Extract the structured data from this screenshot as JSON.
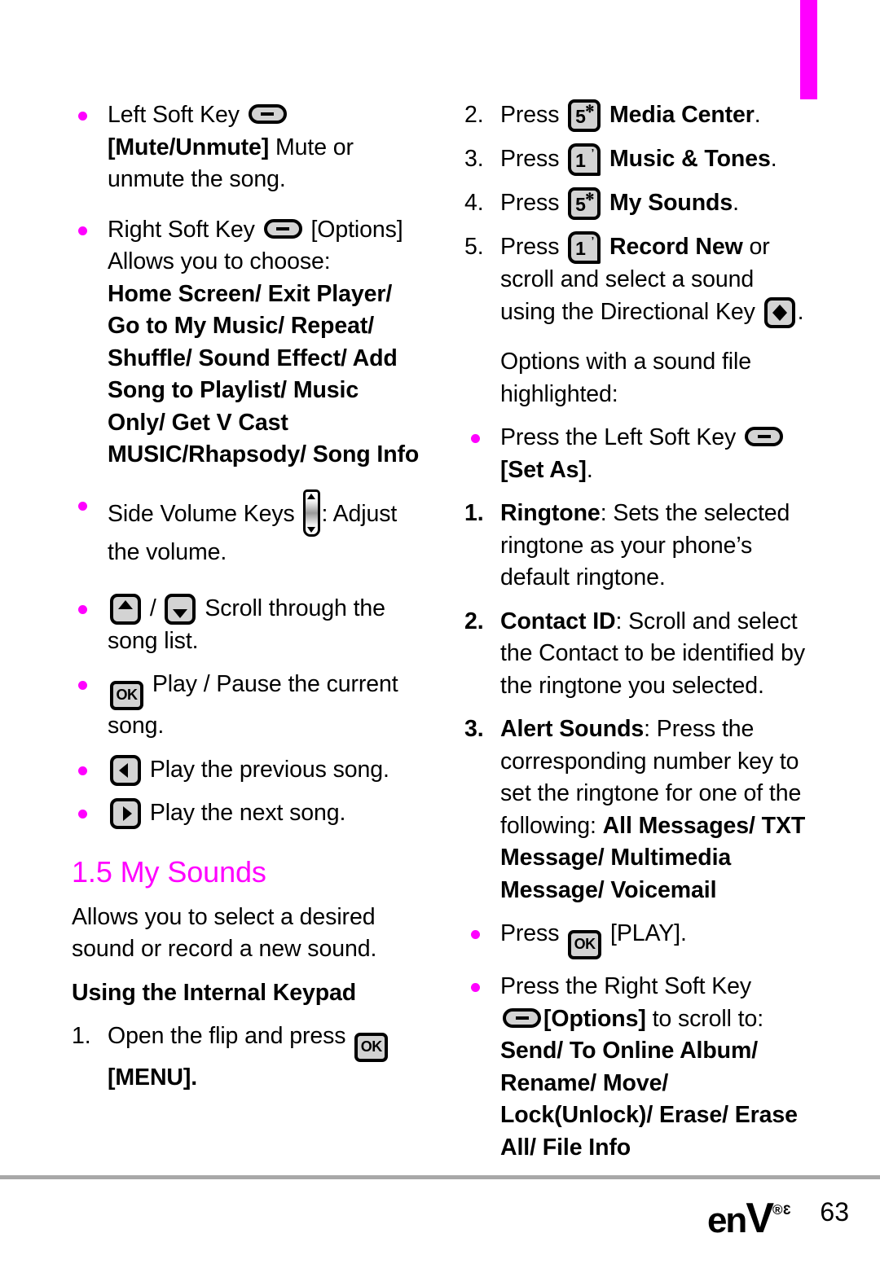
{
  "page": {
    "number": "63",
    "brand": "enV",
    "brand_mark": "®3",
    "accent_color": "#ff00ff",
    "tab_color": "#ff00ff",
    "rule_color": "#a8a8a8"
  },
  "left_column": {
    "b1": {
      "label": "Left Soft Key",
      "icon": "soft-key-icon",
      "bold_text": "[Mute/Unmute]",
      "rest": " Mute or unmute the song."
    },
    "b2": {
      "label": "Right Soft Key",
      "icon": "soft-key-icon",
      "bracket": "[Options]",
      "intro": "Allows you to choose:",
      "options": "Home Screen/ Exit Player/ Go to My Music/ Repeat/ Shuffle/ Sound Effect/ Add Song to Playlist/ Music Only/ Get V Cast MUSIC/Rhapsody/ Song Info"
    },
    "b3": {
      "label": "Side Volume Keys",
      "icon": "side-volume-keys-icon",
      "rest": ": Adjust the volume."
    },
    "b4": {
      "icon_up": "arrow-up-key-icon",
      "sep": "/",
      "icon_down": "arrow-down-key-icon",
      "rest": "Scroll through the song list."
    },
    "b5": {
      "icon": "ok-key-icon",
      "rest": "Play / Pause the current song."
    },
    "b6": {
      "icon": "arrow-left-key-icon",
      "rest": "Play the previous song."
    },
    "b7": {
      "icon": "arrow-right-key-icon",
      "rest": "Play the next song."
    },
    "section": {
      "heading": "1.5 My Sounds",
      "intro": "Allows you to select a desired sound or record a new sound.",
      "subheading": "Using the Internal Keypad",
      "step1": {
        "num": "1.",
        "pre": "Open the flip and press ",
        "icon": "ok-key-icon",
        "post": "[MENU]."
      }
    }
  },
  "right_column": {
    "s2": {
      "num": "2.",
      "pre": "Press ",
      "key_digit": "5",
      "key_sup": "✻",
      "bold": "Media Center",
      "post": "."
    },
    "s3": {
      "num": "3.",
      "pre": "Press ",
      "key_digit": "1",
      "key_sup": "’",
      "bold": "Music & Tones",
      "post": "."
    },
    "s4": {
      "num": "4.",
      "pre": "Press ",
      "key_digit": "5",
      "key_sup": "✻",
      "bold": "My Sounds",
      "post": "."
    },
    "s5": {
      "num": "5.",
      "pre": "Press ",
      "key_digit": "1",
      "key_sup": "’",
      "bold": "Record New",
      "mid": " or scroll and select a sound using the Directional Key ",
      "icon": "directional-key-icon",
      "post": "."
    },
    "options_intro": "Options with a sound file highlighted:",
    "b1": {
      "pre": "Press the Left Soft Key ",
      "icon": "soft-key-icon",
      "bold": "[Set As]",
      "post": "."
    },
    "n1": {
      "num": "1.",
      "bold": "Ringtone",
      "rest": ": Sets the selected ringtone as your phone’s default ringtone."
    },
    "n2": {
      "num": "2.",
      "bold": "Contact ID",
      "rest": ": Scroll and select the Contact to be identified by the ringtone you selected."
    },
    "n3": {
      "num": "3.",
      "bold": "Alert Sounds",
      "rest": ": Press the corresponding number key to set the ringtone for one of the following: ",
      "bold_tail": "All Messages/ TXT Message/ Multimedia Message/ Voicemail"
    },
    "b2": {
      "pre": "Press ",
      "icon": "ok-key-icon",
      "post": "[PLAY]."
    },
    "b3": {
      "pre": "Press the Right Soft Key",
      "icon": "soft-key-icon",
      "bold": "[Options]",
      "mid": " to scroll to:",
      "bold_tail": "Send/ To Online Album/ Rename/ Move/ Lock(Unlock)/ Erase/ Erase All/ File Info"
    }
  }
}
